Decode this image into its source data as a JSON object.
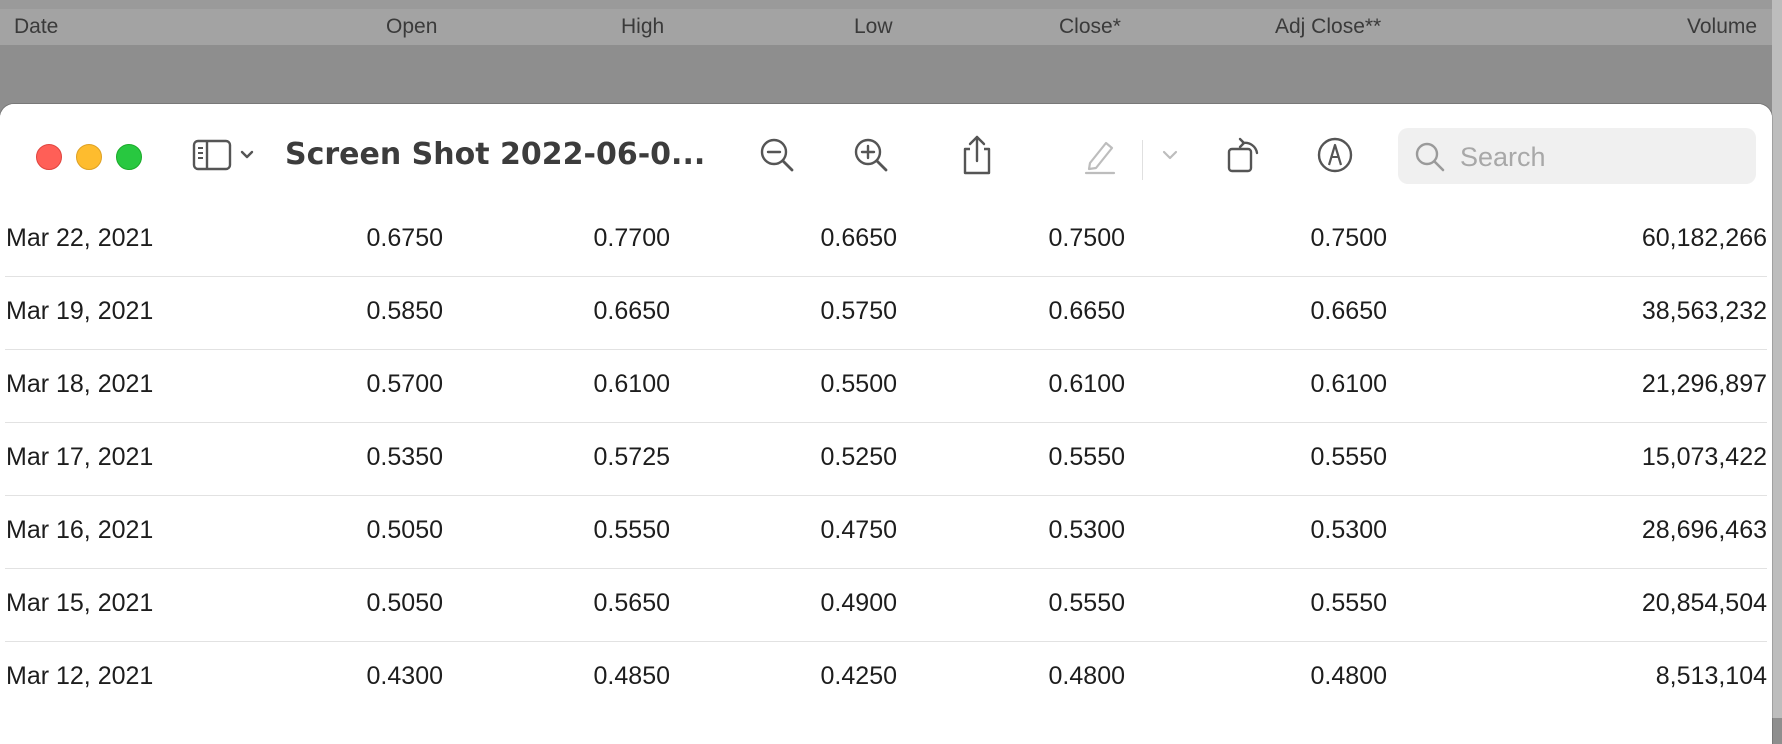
{
  "background_header": {
    "columns": [
      "Date",
      "Open",
      "High",
      "Low",
      "Close*",
      "Adj Close**",
      "Volume"
    ]
  },
  "window": {
    "title": "Screen Shot 2022-06-0...",
    "search": {
      "placeholder": "Search",
      "value": ""
    },
    "toolbar_icons": [
      "sidebar-toggle-icon",
      "zoom-out-icon",
      "zoom-in-icon",
      "share-icon",
      "highlight-icon",
      "rotate-icon",
      "markup-icon",
      "search-icon"
    ]
  },
  "table": {
    "rows": [
      {
        "date": "Mar 22, 2021",
        "open": "0.6750",
        "high": "0.7700",
        "low": "0.6650",
        "close": "0.7500",
        "adj_close": "0.7500",
        "volume": "60,182,266"
      },
      {
        "date": "Mar 19, 2021",
        "open": "0.5850",
        "high": "0.6650",
        "low": "0.5750",
        "close": "0.6650",
        "adj_close": "0.6650",
        "volume": "38,563,232"
      },
      {
        "date": "Mar 18, 2021",
        "open": "0.5700",
        "high": "0.6100",
        "low": "0.5500",
        "close": "0.6100",
        "adj_close": "0.6100",
        "volume": "21,296,897"
      },
      {
        "date": "Mar 17, 2021",
        "open": "0.5350",
        "high": "0.5725",
        "low": "0.5250",
        "close": "0.5550",
        "adj_close": "0.5550",
        "volume": "15,073,422"
      },
      {
        "date": "Mar 16, 2021",
        "open": "0.5050",
        "high": "0.5550",
        "low": "0.4750",
        "close": "0.5300",
        "adj_close": "0.5300",
        "volume": "28,696,463"
      },
      {
        "date": "Mar 15, 2021",
        "open": "0.5050",
        "high": "0.5650",
        "low": "0.4900",
        "close": "0.5550",
        "adj_close": "0.5550",
        "volume": "20,854,504"
      },
      {
        "date": "Mar 12, 2021",
        "open": "0.4300",
        "high": "0.4850",
        "low": "0.4250",
        "close": "0.4800",
        "adj_close": "0.4800",
        "volume": "8,513,104"
      }
    ]
  },
  "colors": {
    "close_light": "#ff5f57",
    "minimize_light": "#febc2e",
    "maximize_light": "#28c840",
    "icon": "#555555",
    "icon_disabled": "#bdbdbd"
  }
}
